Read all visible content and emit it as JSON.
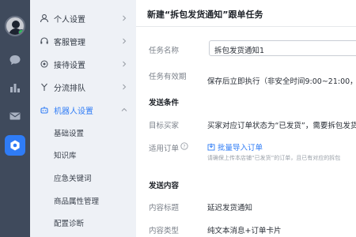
{
  "sidebar": {
    "items": [
      {
        "label": "个人设置",
        "icon": "user-icon"
      },
      {
        "label": "客服管理",
        "icon": "headset-icon"
      },
      {
        "label": "接待设置",
        "icon": "settings-icon"
      },
      {
        "label": "分流排队",
        "icon": "split-icon"
      },
      {
        "label": "机器人设置",
        "icon": "robot-icon"
      }
    ],
    "sub_items": [
      "基础设置",
      "知识库",
      "应急关键词",
      "商品属性管理",
      "配置诊断"
    ]
  },
  "rail": {
    "icons": [
      "avatar",
      "chat-icon",
      "bar-chart-icon",
      "mail-icon",
      "hexagon-settings-icon"
    ],
    "accent": "#2f7cf6"
  },
  "form": {
    "title": "新建“拆包发货通知”跟单任务",
    "task_name_label": "任务名称",
    "task_name_value": "拆包发货通知1",
    "validity_label": "任务有效期",
    "validity_value": "保存后立即执行（非安全时间9:00~21:00，且",
    "send_conditions_title": "发送条件",
    "target_buyer_label": "目标买家",
    "target_buyer_value": "买家对应订单状态为“已发货”，需要拆包发货",
    "applicable_orders_label": "适用订单",
    "import_link": "批量导入订单",
    "import_hint": "请确保上传本店铺“已发货”的订单，且已有对应的拆包",
    "send_content_title": "发送内容",
    "content_title_label": "内容标题",
    "content_title_value": "延迟发货通知",
    "content_type_label": "内容类型",
    "content_type_value": "纯文本消息+订单卡片"
  }
}
